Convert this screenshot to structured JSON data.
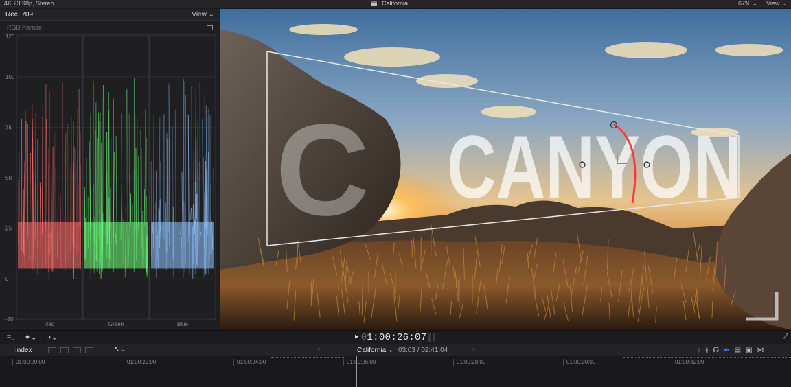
{
  "topbar": {
    "format": "4K 23.98p, Stereo",
    "project_title": "California",
    "zoom": "67% ⌄",
    "view": "View ⌄"
  },
  "scope": {
    "standard": "Rec. 709",
    "view_label": "View ⌄",
    "type": "RGB Parade",
    "scale": [
      "120",
      "100",
      "75",
      "50",
      "25",
      "0",
      "-20"
    ],
    "channels": [
      {
        "label": "Red",
        "color": "#ff6b6b"
      },
      {
        "label": "Green",
        "color": "#6dff7a"
      },
      {
        "label": "Blue",
        "color": "#8fc4ff"
      }
    ]
  },
  "viewer": {
    "title_text": "CANYON"
  },
  "playback": {
    "timecode_dim": "0",
    "timecode": "1:00:26:07"
  },
  "timeline": {
    "index_label": "Index",
    "project_name": "California ⌄",
    "position": "03:03 / 02:41:04",
    "ruler": [
      "01:00:20:00",
      "01:00:22:00",
      "01:00:24:00",
      "01:00:26:00",
      "01:00:28:00",
      "01:00:30:00",
      "01:00:32:00"
    ]
  },
  "colors": {
    "accent_blue": "#4f8bff",
    "rotation_handle": "#ff3b3b"
  }
}
